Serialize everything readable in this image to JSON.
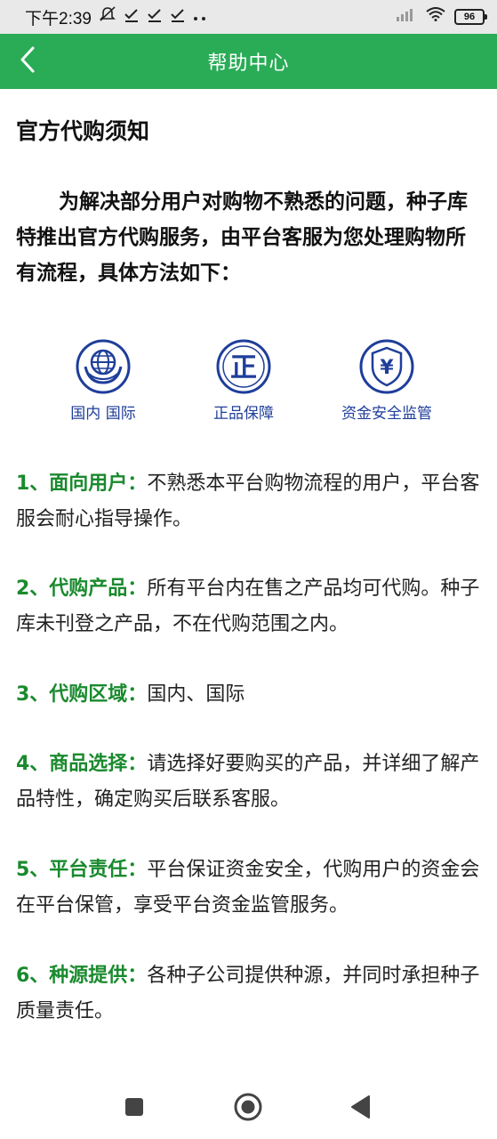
{
  "status_bar": {
    "time": "下午2:39",
    "battery": "96"
  },
  "app_bar": {
    "title": "帮助中心"
  },
  "article": {
    "title": "官方代购须知",
    "intro": "为解决部分用户对购物不熟悉的问题，种子库特推出官方代购服务，由平台客服为您处理购物所有流程，具体方法如下：",
    "badges": [
      {
        "label": "国内 国际",
        "icon": "globe-hands-icon"
      },
      {
        "label": "正品保障",
        "icon": "genuine-icon",
        "glyph": "正"
      },
      {
        "label": "资金安全监管",
        "icon": "yuan-shield-icon",
        "glyph": "¥"
      }
    ],
    "items": [
      {
        "title": "1、面向用户：",
        "text": "不熟悉本平台购物流程的用户，平台客服会耐心指导操作。"
      },
      {
        "title": "2、代购产品：",
        "text": "所有平台内在售之产品均可代购。种子库未刊登之产品，不在代购范围之内。"
      },
      {
        "title": "3、代购区域：",
        "text": "国内、国际"
      },
      {
        "title": "4、商品选择：",
        "text": "请选择好要购买的产品，并详细了解产品特性，确定购买后联系客服。"
      },
      {
        "title": "5、平台责任：",
        "text": "平台保证资金安全，代购用户的资金会在平台保管，享受平台资金监管服务。"
      },
      {
        "title": "6、种源提供：",
        "text": "各种子公司提供种源，并同时承担种子质量责任。"
      }
    ]
  },
  "colors": {
    "brand_green": "#2aac57",
    "item_title_green": "#1a8a2e",
    "badge_blue": "#1f3e9a"
  }
}
